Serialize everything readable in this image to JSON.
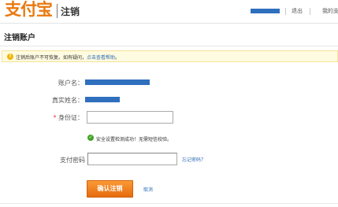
{
  "header": {
    "logo_text": "支付宝",
    "title": "注销",
    "logout_label": "退出",
    "my_account_label": "我的支"
  },
  "page": {
    "title": "注销账户"
  },
  "notice": {
    "text": "注销后账户不可恢复。如有疑问，",
    "link": "点击查看帮助",
    "tail": "。"
  },
  "form": {
    "account_label": "账户名：",
    "realname_label": "真实姓名：",
    "idcard_required_mark": "*",
    "idcard_label": "身份证：",
    "idcard_value": "",
    "security_check_text": "安全设置检测成功！无需短信校验。",
    "paypwd_label": "支付密码",
    "paypwd_value": "",
    "forgot_label": "忘记密码？",
    "confirm_label": "确认注销",
    "cancel_label": "取消"
  },
  "colors": {
    "brand_orange": "#e9790f",
    "redaction_blue": "#2f6fbe",
    "link_blue": "#2d6eb6",
    "success_green": "#43a32a"
  }
}
